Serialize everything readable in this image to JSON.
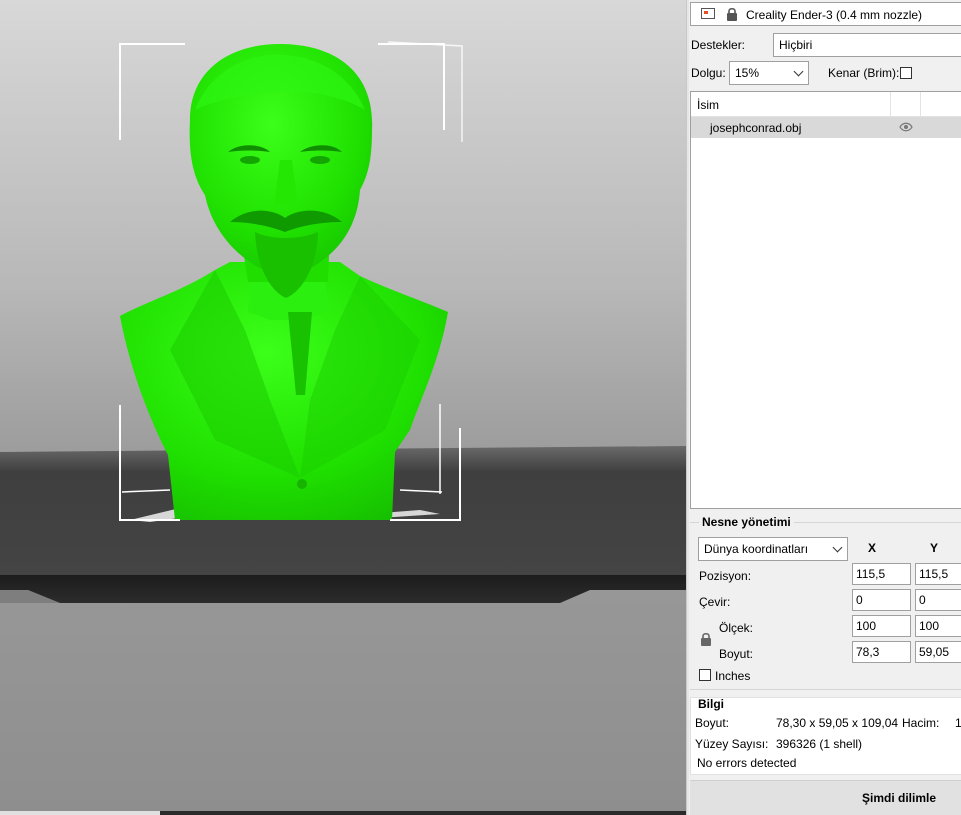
{
  "printer": {
    "label": "Creality Ender-3 (0.4 mm nozzle)",
    "icon": "printer-icon",
    "lock_icon": "lock-icon"
  },
  "supports": {
    "label": "Destekler:",
    "value": "Hiçbiri"
  },
  "infill": {
    "label": "Dolgu:",
    "value": "15%",
    "brim_label": "Kenar (Brim):",
    "brim_checked": false
  },
  "object_list": {
    "column_name": "İsim",
    "items": [
      {
        "name": "josephconrad.obj",
        "visible": true
      }
    ]
  },
  "object_manager": {
    "title": "Nesne yönetimi",
    "coord_system": "Dünya koordinatları",
    "axes": [
      "X",
      "Y"
    ],
    "rows": [
      {
        "label": "Pozisyon:",
        "values": [
          "115,5",
          "115,5"
        ]
      },
      {
        "label": "Çevir:",
        "values": [
          "0",
          "0"
        ]
      },
      {
        "label": "Ölçek:",
        "values": [
          "100",
          "100"
        ]
      },
      {
        "label": "Boyut:",
        "values": [
          "78,3",
          "59,05"
        ]
      }
    ],
    "inches_label": "Inches",
    "inches_checked": false
  },
  "info": {
    "title": "Bilgi",
    "size_label": "Boyut:",
    "size_value": "78,30 x 59,05 x 109,04",
    "volume_label": "Hacim:",
    "volume_value": "1",
    "facets_label": "Yüzey Sayısı:",
    "facets_value": "396326 (1 shell)",
    "status": "No errors detected"
  },
  "slice_button": "Şimdi dilimle",
  "colors": {
    "model": "#22e600",
    "viewport_top": "#d8d8d8",
    "bed": "#3a3a3a"
  }
}
